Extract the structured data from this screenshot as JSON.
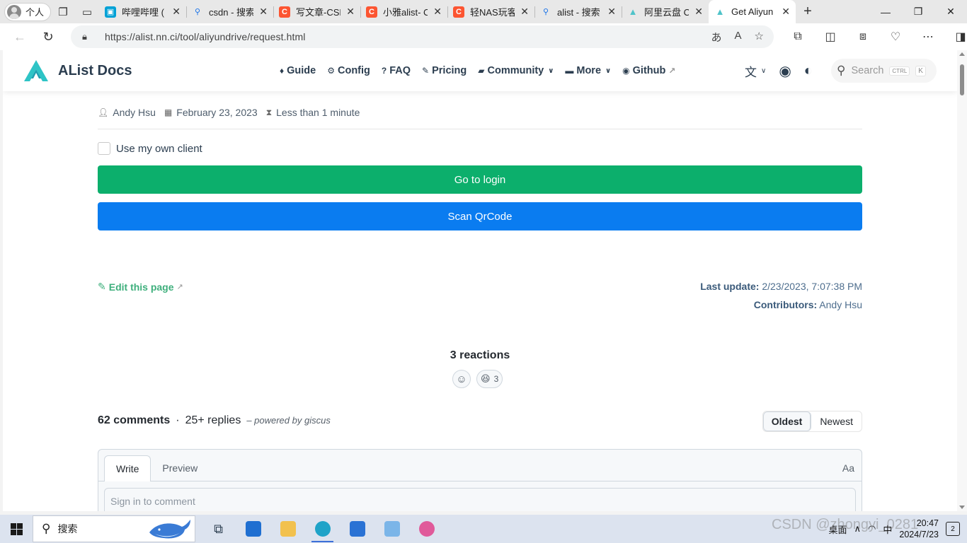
{
  "browser": {
    "profile_label": "个人",
    "tabs": [
      {
        "label": "哔哩哔哩 (",
        "icon": "bilibili-icon",
        "color": "#00a1d6"
      },
      {
        "label": "csdn - 搜索",
        "icon": "search-icon",
        "color": "#1a73e8"
      },
      {
        "label": "写文章-CSD",
        "icon": "csdn-icon",
        "color": "#fc5531"
      },
      {
        "label": "小雅alist- C",
        "icon": "csdn-icon",
        "color": "#fc5531"
      },
      {
        "label": "轻NAS玩客",
        "icon": "csdn-icon",
        "color": "#fc5531"
      },
      {
        "label": "alist - 搜索",
        "icon": "search-icon",
        "color": "#1a73e8"
      },
      {
        "label": "阿里云盘 C",
        "icon": "alist-icon",
        "color": "#4fc3c9"
      },
      {
        "label": "Get Aliyun",
        "icon": "alist-icon",
        "color": "#4fc3c9"
      }
    ],
    "url": "https://alist.nn.ci/tool/aliyundrive/request.html"
  },
  "site": {
    "brand": "AList Docs",
    "nav": [
      {
        "label": "Guide",
        "icon": "guide-icon",
        "caret": false
      },
      {
        "label": "Config",
        "icon": "config-icon",
        "caret": false
      },
      {
        "label": "FAQ",
        "icon": "faq-icon",
        "caret": false
      },
      {
        "label": "Pricing",
        "icon": "pricing-icon",
        "caret": false
      },
      {
        "label": "Community",
        "icon": "community-icon",
        "caret": true
      },
      {
        "label": "More",
        "icon": "more-icon",
        "caret": true
      },
      {
        "label": "Github",
        "icon": "github-icon",
        "caret": false
      }
    ],
    "search_placeholder": "Search",
    "search_kbd_ctrl": "CTRL",
    "search_kbd_key": "K",
    "accent_color": "#3eaf7c"
  },
  "page": {
    "author": "Andy Hsu",
    "date": "February 23, 2023",
    "read_time": "Less than 1 minute",
    "own_client_label": "Use my own client",
    "login_button": "Go to login",
    "qr_button": "Scan QrCode",
    "edit_link": "Edit this page",
    "last_update_label": "Last update:",
    "last_update_value": "2/23/2023, 7:07:38 PM",
    "contributors_label": "Contributors:",
    "contributors_value": "Andy Hsu",
    "login_color": "#0caf6c",
    "qr_color": "#0a7cf0"
  },
  "giscus": {
    "reactions_title": "3 reactions",
    "reaction_count": "3",
    "comments_count": "62 comments",
    "separator": "·",
    "replies_count": "25+ replies",
    "powered_by": "– powered by giscus",
    "sort_oldest": "Oldest",
    "sort_newest": "Newest",
    "tab_write": "Write",
    "tab_preview": "Preview",
    "aa_label": "Aa",
    "comment_placeholder": "Sign in to comment"
  },
  "taskbar": {
    "search_label": "搜索",
    "desktop_label": "桌面",
    "ime_label": "中",
    "time": "20:47",
    "date": "2024/7/23",
    "notification_count": "2",
    "watermark": "CSDN @zhongyi_0281"
  }
}
